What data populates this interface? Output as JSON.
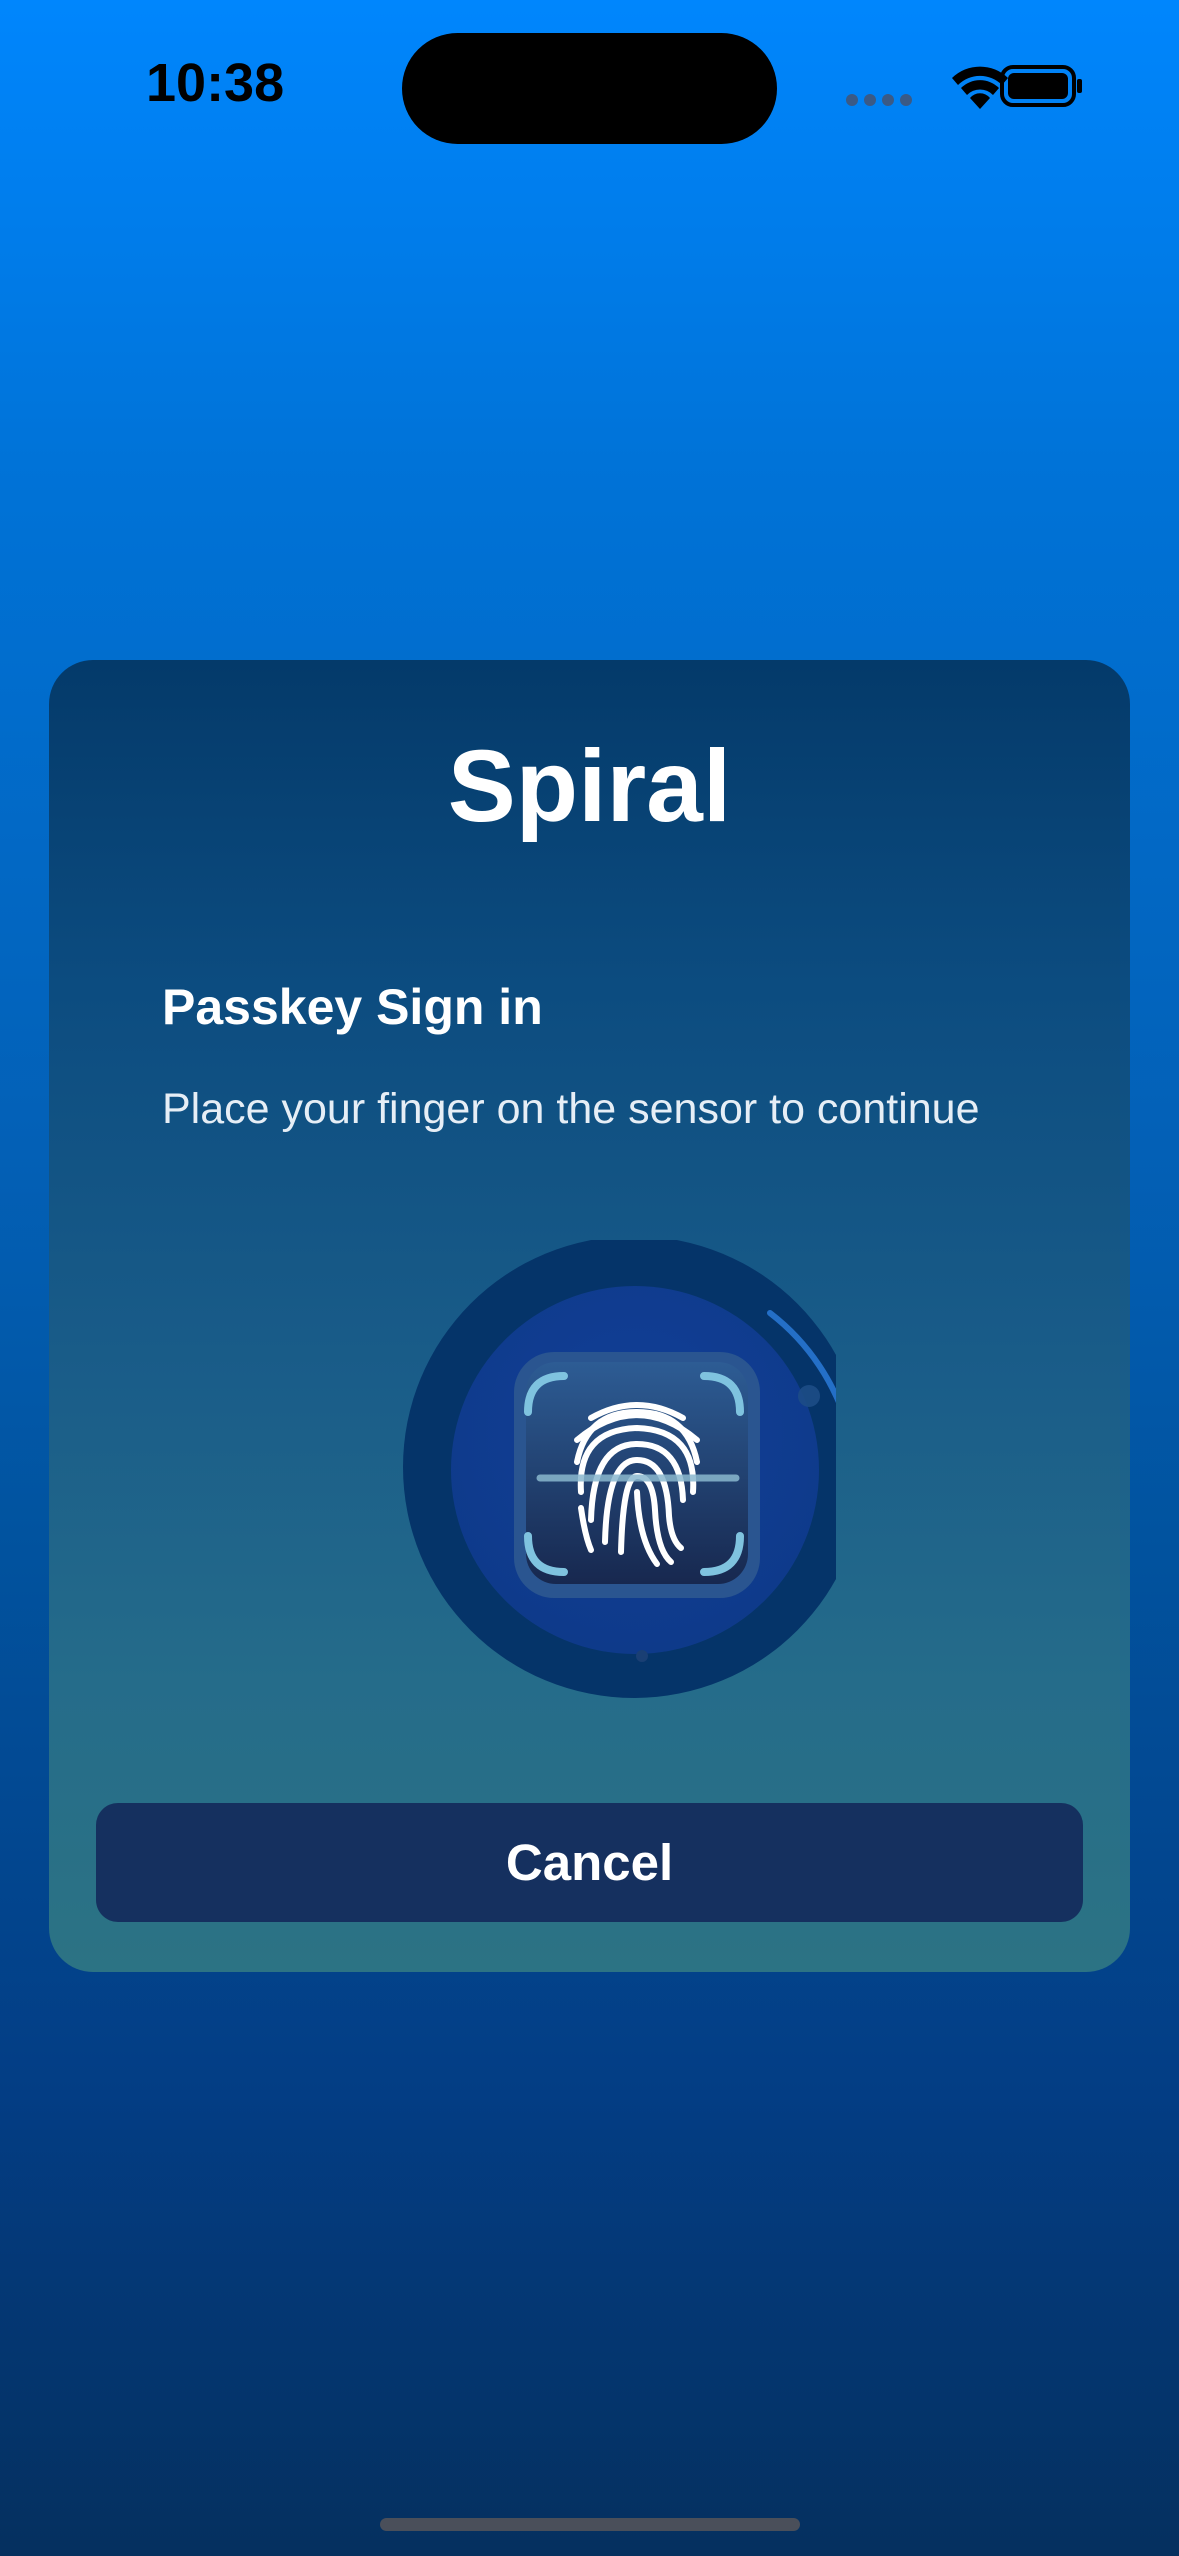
{
  "status_bar": {
    "time": "10:38",
    "icons": [
      "cellular-signal-icon",
      "wifi-icon",
      "battery-icon"
    ]
  },
  "dialog": {
    "app_title": "Spiral",
    "heading": "Passkey Sign in",
    "instruction": "Place your finger on the sensor to continue",
    "scanner_icon": "fingerprint-icon",
    "cancel_label": "Cancel"
  },
  "colors": {
    "background_top": "#0086fd",
    "background_bottom": "#05305f",
    "card_top": "#043a6a",
    "card_bottom": "#2c7384",
    "button": "#15305f",
    "scanner_ring": "#053469",
    "scanner_inner": "#0f3e94",
    "progress_arc": "#2a7ad8"
  }
}
